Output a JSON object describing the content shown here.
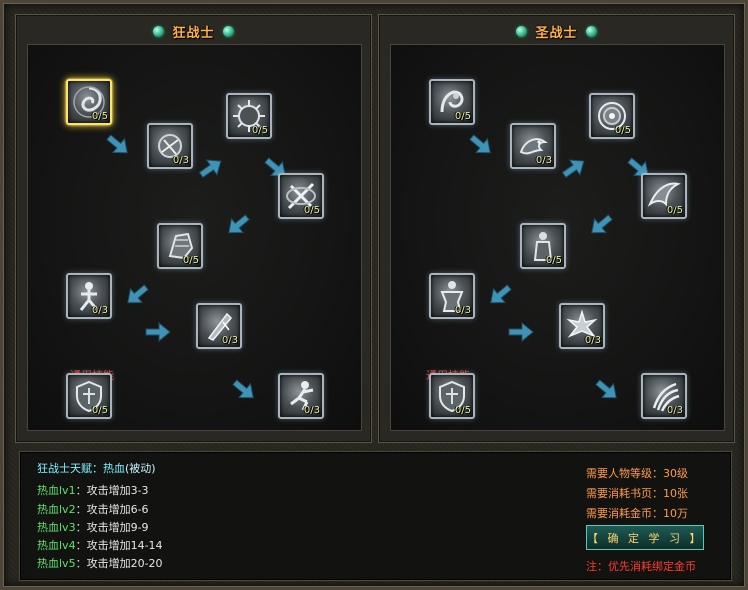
{
  "panels": [
    {
      "title": "狂战士",
      "common_label": "通用技能",
      "skills": [
        {
          "count": "0/5",
          "icon": "swirl-shield-icon",
          "selected": true
        },
        {
          "count": "0/3",
          "icon": "blood-rage-icon",
          "selected": false
        },
        {
          "count": "0/5",
          "icon": "spiked-orb-icon",
          "selected": false
        },
        {
          "count": "0/5",
          "icon": "crossed-blades-icon",
          "selected": false
        },
        {
          "count": "0/5",
          "icon": "armored-fist-icon",
          "selected": false
        },
        {
          "count": "0/3",
          "icon": "warrior-stance-icon",
          "selected": false
        },
        {
          "count": "0/3",
          "icon": "blade-strike-icon",
          "selected": false
        },
        {
          "count": "0/5",
          "icon": "crest-shield-icon",
          "selected": false
        },
        {
          "count": "0/3",
          "icon": "leaping-warrior-icon",
          "selected": false
        }
      ]
    },
    {
      "title": "圣战士",
      "common_label": "通用技能",
      "skills": [
        {
          "count": "0/5",
          "icon": "strong-arm-icon",
          "selected": false
        },
        {
          "count": "0/3",
          "icon": "dragon-icon",
          "selected": false
        },
        {
          "count": "0/5",
          "icon": "holy-ring-icon",
          "selected": false
        },
        {
          "count": "0/5",
          "icon": "wing-slash-icon",
          "selected": false
        },
        {
          "count": "0/5",
          "icon": "guardian-figure-icon",
          "selected": false
        },
        {
          "count": "0/3",
          "icon": "muscle-figure-icon",
          "selected": false
        },
        {
          "count": "0/3",
          "icon": "radiant-burst-icon",
          "selected": false
        },
        {
          "count": "0/5",
          "icon": "crest-shield-icon",
          "selected": false
        },
        {
          "count": "0/3",
          "icon": "claw-swipe-icon",
          "selected": false
        }
      ]
    }
  ],
  "info": {
    "talent_title": "狂战士天赋：热血",
    "talent_type": "(被动)",
    "levels": [
      {
        "lv": "热血lv1",
        "sep": "：",
        "desc": "攻击增加3-3"
      },
      {
        "lv": "热血lv2",
        "sep": "：",
        "desc": "攻击增加6-6"
      },
      {
        "lv": "热血lv3",
        "sep": "：",
        "desc": "攻击增加9-9"
      },
      {
        "lv": "热血lv4",
        "sep": "：",
        "desc": "攻击增加14-14"
      },
      {
        "lv": "热血lv5",
        "sep": "：",
        "desc": "攻击增加20-20"
      }
    ],
    "requirements": [
      "需要人物等级：30级",
      "需要消耗书页：10张",
      "需要消耗金币：10万"
    ],
    "learn_button": "【 确 定 学 习 】",
    "note": "注：优先消耗绑定金币"
  },
  "colors": {
    "title": "#ffb14a",
    "count": "#e9f0a0",
    "common_label": "#e23b2f",
    "talent_title": "#7df2ff",
    "level_name": "#5de36a",
    "requirement": "#ff9b4a",
    "note": "#ff3b2f"
  }
}
